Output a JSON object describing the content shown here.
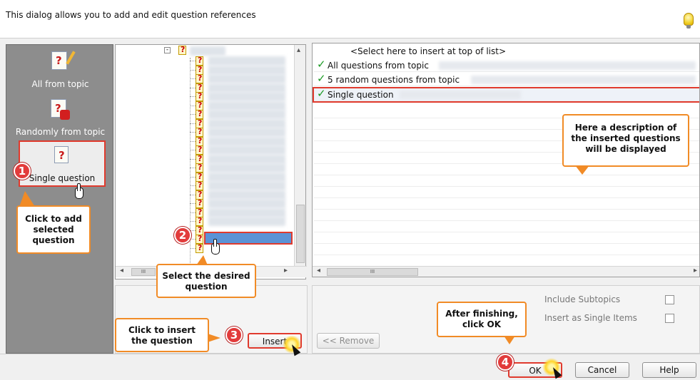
{
  "header": {
    "description": "This dialog allows you to add and edit question references",
    "hint_icon": "lightbulb-icon"
  },
  "left_panel": {
    "items": [
      {
        "label": "All from topic",
        "icon": "question-doc-icon"
      },
      {
        "label": "Randomly from topic",
        "icon": "random-dice-icon"
      },
      {
        "label": "Single question",
        "icon": "question-page-icon"
      }
    ]
  },
  "tree": {
    "scroll_left": "◂",
    "scroll_right": "▸",
    "scroll_up": "▴",
    "thumb_marks": "III"
  },
  "references": {
    "insert_top": "<Select here to insert at top of list>",
    "rows": [
      {
        "text": "All questions from topic",
        "checked": true
      },
      {
        "text": "5 random questions from topic",
        "checked": true
      },
      {
        "text": "Single question",
        "checked": true
      }
    ],
    "scroll_left": "◂",
    "scroll_right": "▸",
    "thumb_marks": "III"
  },
  "buttons": {
    "insert": "Insert",
    "remove": "<< Remove",
    "ok": "OK",
    "cancel": "Cancel",
    "help": "Help"
  },
  "options": {
    "include_subtopics": "Include Subtopics",
    "insert_single_items": "Insert as Single Items"
  },
  "callouts": {
    "c1": "Click to add selected question",
    "c2": "Select the desired question",
    "c3": "Click to insert the question",
    "c4": "After finishing, click OK",
    "c5": "Here a description of the inserted questions will be displayed"
  },
  "badges": {
    "b1": "1",
    "b2": "2",
    "b3": "3",
    "b4": "4"
  },
  "colors": {
    "accent": "#e03a2d",
    "callout_border": "#f18b26",
    "badge": "#e23b3b",
    "check": "#1b9a24",
    "selection": "#5b93d6"
  }
}
